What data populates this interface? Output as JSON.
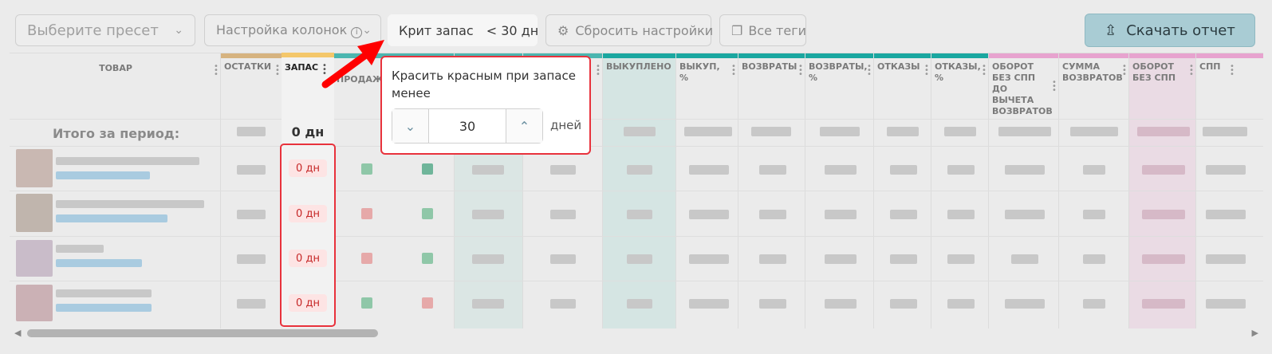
{
  "toolbar": {
    "preset_placeholder": "Выберите пресет",
    "columns_label": "Настройка колонок",
    "crit_label": "Крит запас",
    "crit_value": "< 30 дн",
    "reset_label": "Сбросить настройки",
    "tags_label": "Все теги",
    "download_label": "Скачать отчет"
  },
  "table": {
    "product_header": "ТОВАР",
    "columns": [
      {
        "label": "ОСТАТКИ",
        "strip": "#d6b380"
      },
      {
        "label": "ЗАПАС",
        "strip": "#f4c76a"
      },
      {
        "label": "ПРОДАЖА",
        "strip": "#4bb6b0"
      },
      {
        "label": "ВЫКУПЛЕНО",
        "strip": "#1aa7a0"
      },
      {
        "label": "ВЫКУП, %",
        "strip": "#1aa7a0"
      },
      {
        "label": "ВОЗВРАТЫ",
        "strip": "#1aa7a0"
      },
      {
        "label": "ВОЗВРАТЫ, %",
        "strip": "#1aa7a0"
      },
      {
        "label": "ОТКАЗЫ",
        "strip": "#1aa7a0"
      },
      {
        "label": "ОТКАЗЫ, %",
        "strip": "#1aa7a0"
      },
      {
        "label": "ОБОРОТ БЕЗ СПП ДО ВЫЧЕТА ВОЗВРАТОВ",
        "strip": "#e7a3cf"
      },
      {
        "label": "СУММА ВОЗВРАТОВ",
        "strip": "#e7a3cf"
      },
      {
        "label": "ОБОРОТ БЕЗ СПП",
        "strip": "#e7a3cf"
      },
      {
        "label": "СПП",
        "strip": "#e7a3cf"
      }
    ],
    "total_label": "Итого за период:",
    "zapas_total": "0 дн",
    "zapas_values": [
      "0 дн",
      "0 дн",
      "0 дн",
      "0 дн"
    ]
  },
  "popover": {
    "text": "Красить красным при запасе менее",
    "value": "30",
    "unit": "дней"
  },
  "colors": {
    "accent_red": "#e8323c",
    "badge_bg": "#fde4e4",
    "download_bg": "#a9ccd4"
  }
}
